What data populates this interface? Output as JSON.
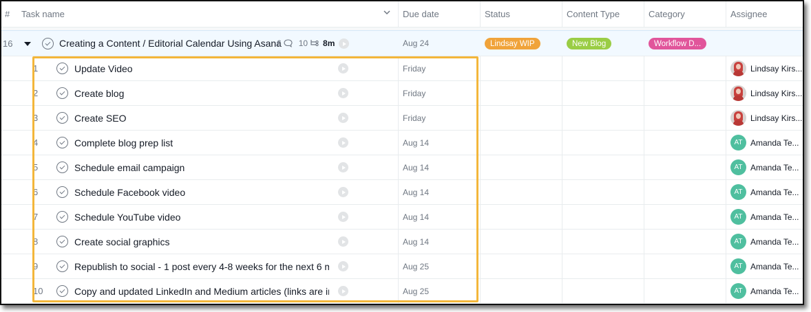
{
  "header": {
    "num": "#",
    "task_name": "Task name",
    "due_date": "Due date",
    "status": "Status",
    "content_type": "Content Type",
    "category": "Category",
    "assignee": "Assignee"
  },
  "parent_task": {
    "row_number": "16",
    "name": "Creating a Content / Editorial Calendar Using Asana",
    "comments": "6",
    "subtasks": "10",
    "time": "8m",
    "due": "Aug 24",
    "status": {
      "label": "Lindsay WIP",
      "color": "#f0a33a"
    },
    "content_type": {
      "label": "New Blog",
      "color": "#9acd45"
    },
    "category": {
      "label": "Workflow D...",
      "color": "#e1559b"
    }
  },
  "subtasks": [
    {
      "n": "1",
      "name": "Update Video",
      "due": "Friday",
      "assignee": "Lindsay Kirs...",
      "avatar": "photo"
    },
    {
      "n": "2",
      "name": "Create blog",
      "due": "Friday",
      "assignee": "Lindsay Kirs...",
      "avatar": "photo"
    },
    {
      "n": "3",
      "name": "Create SEO",
      "due": "Friday",
      "assignee": "Lindsay Kirs...",
      "avatar": "photo"
    },
    {
      "n": "4",
      "name": "Complete blog prep list",
      "due": "Aug 14",
      "assignee": "Amanda Te...",
      "avatar": "AT"
    },
    {
      "n": "5",
      "name": "Schedule email campaign",
      "due": "Aug 14",
      "assignee": "Amanda Te...",
      "avatar": "AT"
    },
    {
      "n": "6",
      "name": "Schedule Facebook video",
      "due": "Aug 14",
      "assignee": "Amanda Te...",
      "avatar": "AT"
    },
    {
      "n": "7",
      "name": "Schedule YouTube video",
      "due": "Aug 14",
      "assignee": "Amanda Te...",
      "avatar": "AT"
    },
    {
      "n": "8",
      "name": "Create social graphics",
      "due": "Aug 14",
      "assignee": "Amanda Te...",
      "avatar": "AT"
    },
    {
      "n": "9",
      "name": "Republish to social - 1 post every 4-8 weeks for the next 6 m",
      "due": "Aug 25",
      "assignee": "Amanda Te...",
      "avatar": "AT"
    },
    {
      "n": "10",
      "name": "Copy and updated LinkedIn and Medium articles (links are in",
      "due": "Aug 25",
      "assignee": "Amanda Te...",
      "avatar": "AT"
    }
  ],
  "colors": {
    "highlight": "#f3b63a",
    "avatar_at": "#4fbf9f"
  }
}
